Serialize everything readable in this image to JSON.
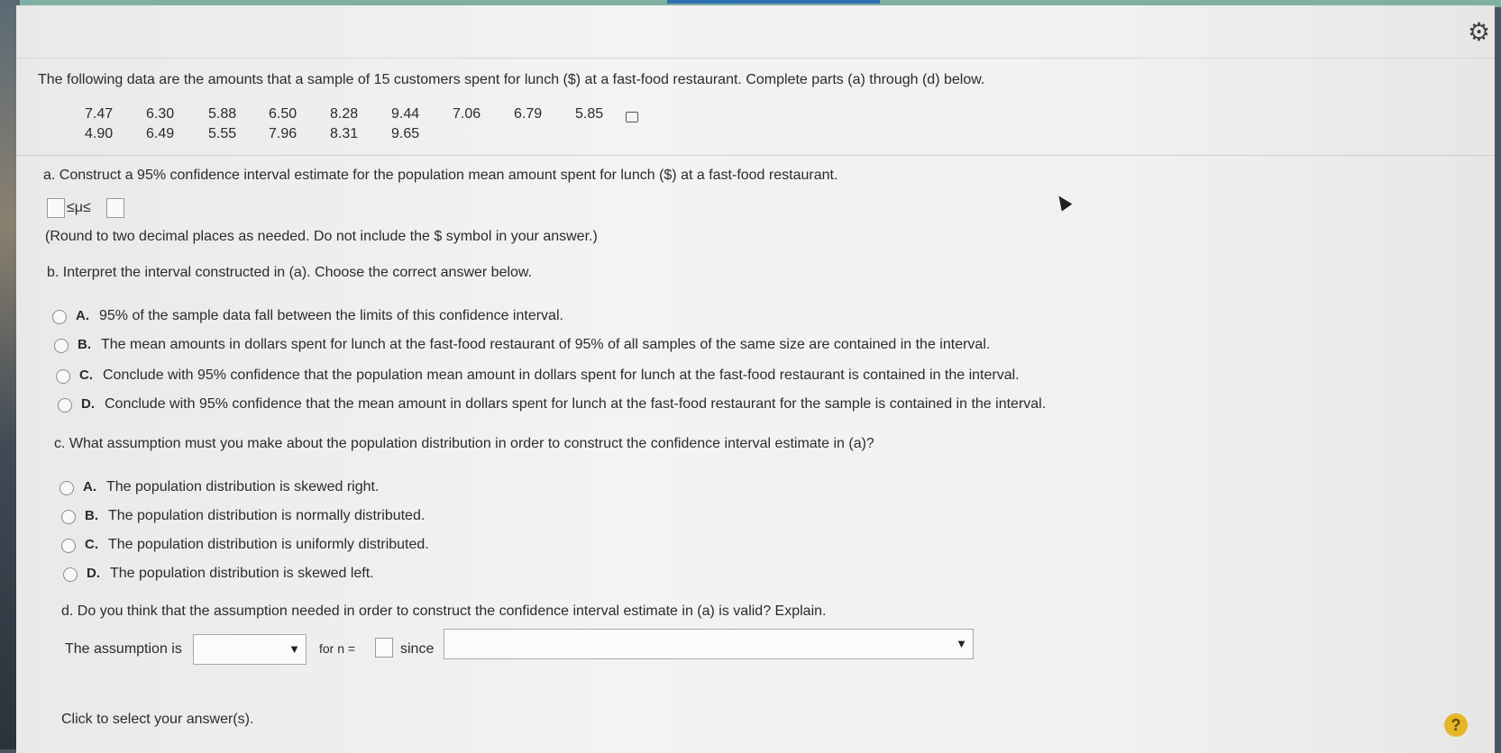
{
  "intro": "The following data are the amounts that a sample of 15 customers spent for lunch ($) at a fast-food restaurant. Complete parts (a) through (d) below.",
  "data_row1": [
    "7.47",
    "6.30",
    "5.88",
    "6.50",
    "8.28",
    "9.44",
    "7.06",
    "6.79",
    "5.85"
  ],
  "data_row2": [
    "4.90",
    "6.49",
    "5.55",
    "7.96",
    "8.31",
    "9.65"
  ],
  "part_a": {
    "question": "a. Construct a 95% confidence interval estimate for the population mean amount spent for lunch ($) at a fast-food restaurant.",
    "interval_symbol": "≤μ≤",
    "lower_value": "",
    "upper_value": "",
    "note": "(Round to two decimal places as needed. Do not include the $ symbol in your answer.)"
  },
  "part_b": {
    "question": "b. Interpret the interval constructed in (a). Choose the correct answer below.",
    "options": [
      {
        "letter": "A.",
        "text": "95% of the sample data fall between the limits of this confidence interval."
      },
      {
        "letter": "B.",
        "text": "The mean amounts in dollars spent for lunch at the fast-food restaurant of 95% of all samples of the same size are contained in the interval."
      },
      {
        "letter": "C.",
        "text": "Conclude with 95% confidence that the population mean amount in dollars spent for lunch at the fast-food restaurant is contained in the interval."
      },
      {
        "letter": "D.",
        "text": "Conclude with 95% confidence that the mean amount in dollars spent for lunch at the fast-food restaurant for the sample is contained in the interval."
      }
    ]
  },
  "part_c": {
    "question": "c. What assumption must you make about the population distribution in order to construct the confidence interval estimate in (a)?",
    "options": [
      {
        "letter": "A.",
        "text": "The population distribution is skewed right."
      },
      {
        "letter": "B.",
        "text": "The population distribution is normally distributed."
      },
      {
        "letter": "C.",
        "text": "The population distribution is uniformly distributed."
      },
      {
        "letter": "D.",
        "text": "The population distribution is skewed left."
      }
    ]
  },
  "part_d": {
    "question": "d. Do you think that the assumption needed in order to construct the confidence interval estimate in (a) is valid? Explain.",
    "prefix": "The assumption is",
    "select1_value": "",
    "for_n": "for n =",
    "n_value": "",
    "since": "since",
    "select2_value": ""
  },
  "footer": "Click to select your answer(s).",
  "help_label": "?",
  "gear_icon": "gear-icon"
}
